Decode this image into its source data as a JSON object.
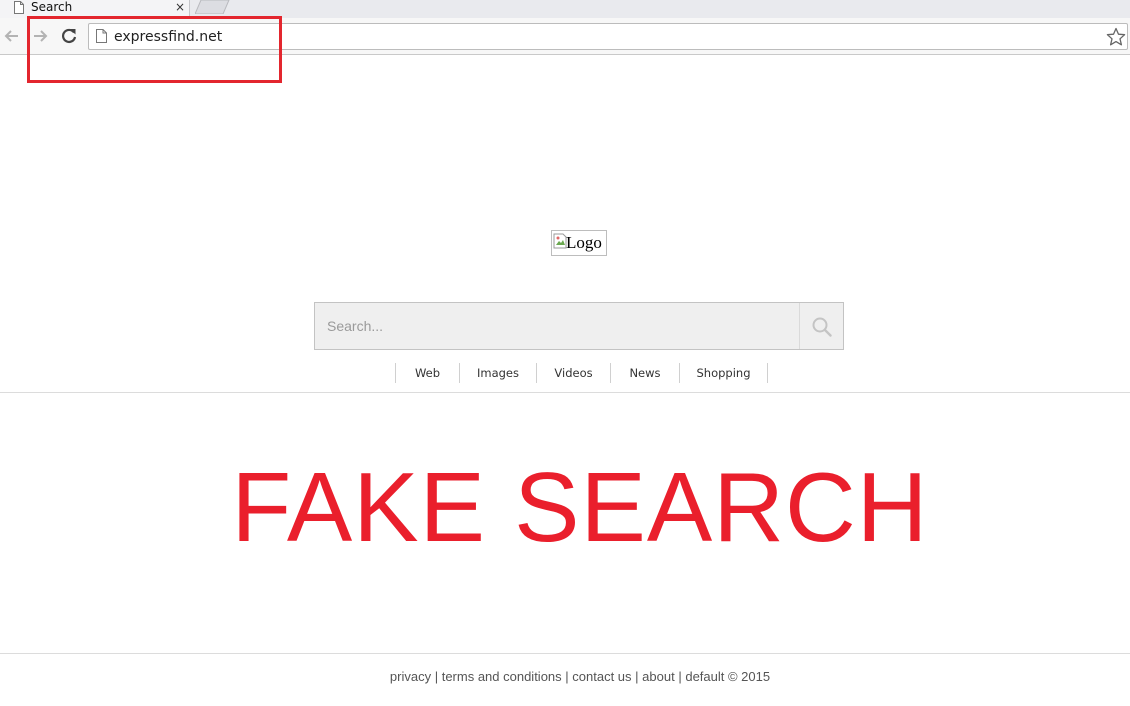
{
  "browser": {
    "tab": {
      "title": "Search",
      "close_glyph": "×"
    },
    "address_bar": {
      "url": "expressfind.net"
    },
    "icons": {
      "back": "arrow-left-icon",
      "forward": "arrow-right-icon",
      "reload": "reload-icon",
      "page": "page-icon",
      "bookmark": "star-icon"
    }
  },
  "annotation": {
    "highlight_color": "#e3262e"
  },
  "page": {
    "logo_alt": "Logo",
    "search": {
      "placeholder": "Search..."
    },
    "verticals": [
      "Web",
      "Images",
      "Videos",
      "News",
      "Shopping"
    ],
    "stamp_text": "FAKE SEARCH",
    "stamp_color": "#ea1f2c",
    "footer": {
      "links": [
        "privacy",
        "terms and conditions",
        "contact us",
        "about"
      ],
      "copyright": "default © 2015"
    }
  }
}
